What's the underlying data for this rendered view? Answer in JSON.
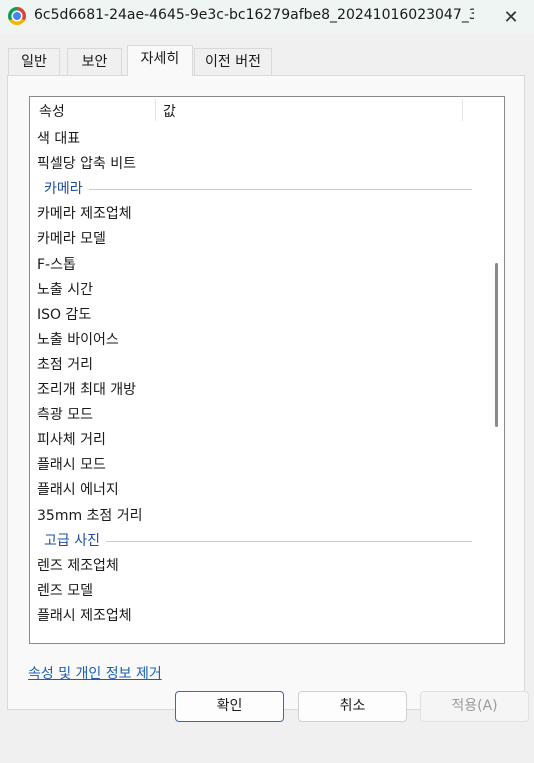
{
  "window": {
    "title": "6c5d6681-24ae-4645-9e3c-bc16279afbe8_20241016023047_300x30...",
    "app_icon": "chrome-icon",
    "close_label": "✕"
  },
  "tabs": [
    {
      "label": "일반",
      "active": false
    },
    {
      "label": "보안",
      "active": false
    },
    {
      "label": "자세히",
      "active": true
    },
    {
      "label": "이전 버전",
      "active": false
    }
  ],
  "list": {
    "column_property": "속성",
    "column_value": "값",
    "rows": [
      {
        "kind": "item",
        "label": "색 대표"
      },
      {
        "kind": "item",
        "label": "픽셀당 압축 비트"
      },
      {
        "kind": "group",
        "label": "카메라"
      },
      {
        "kind": "item",
        "label": "카메라 제조업체"
      },
      {
        "kind": "item",
        "label": "카메라 모델"
      },
      {
        "kind": "item",
        "label": "F-스톱"
      },
      {
        "kind": "item",
        "label": "노출 시간"
      },
      {
        "kind": "item",
        "label": "ISO 감도"
      },
      {
        "kind": "item",
        "label": "노출 바이어스"
      },
      {
        "kind": "item",
        "label": "초점 거리"
      },
      {
        "kind": "item",
        "label": "조리개 최대 개방"
      },
      {
        "kind": "item",
        "label": "측광 모드"
      },
      {
        "kind": "item",
        "label": "피사체 거리"
      },
      {
        "kind": "item",
        "label": "플래시 모드"
      },
      {
        "kind": "item",
        "label": "플래시 에너지"
      },
      {
        "kind": "item",
        "label": "35mm 초점 거리"
      },
      {
        "kind": "group",
        "label": "고급 사진"
      },
      {
        "kind": "item",
        "label": "렌즈 제조업체"
      },
      {
        "kind": "item",
        "label": "렌즈 모델"
      },
      {
        "kind": "item",
        "label": "플래시 제조업체"
      }
    ]
  },
  "remove_link": "속성 및 개인 정보 제거",
  "buttons": {
    "ok": "확인",
    "cancel": "취소",
    "apply": "적용(A)"
  },
  "colors": {
    "accent_link": "#1a5fb4",
    "group_label": "#1f4f9a",
    "titlebar_bg": "#eef5f3"
  }
}
